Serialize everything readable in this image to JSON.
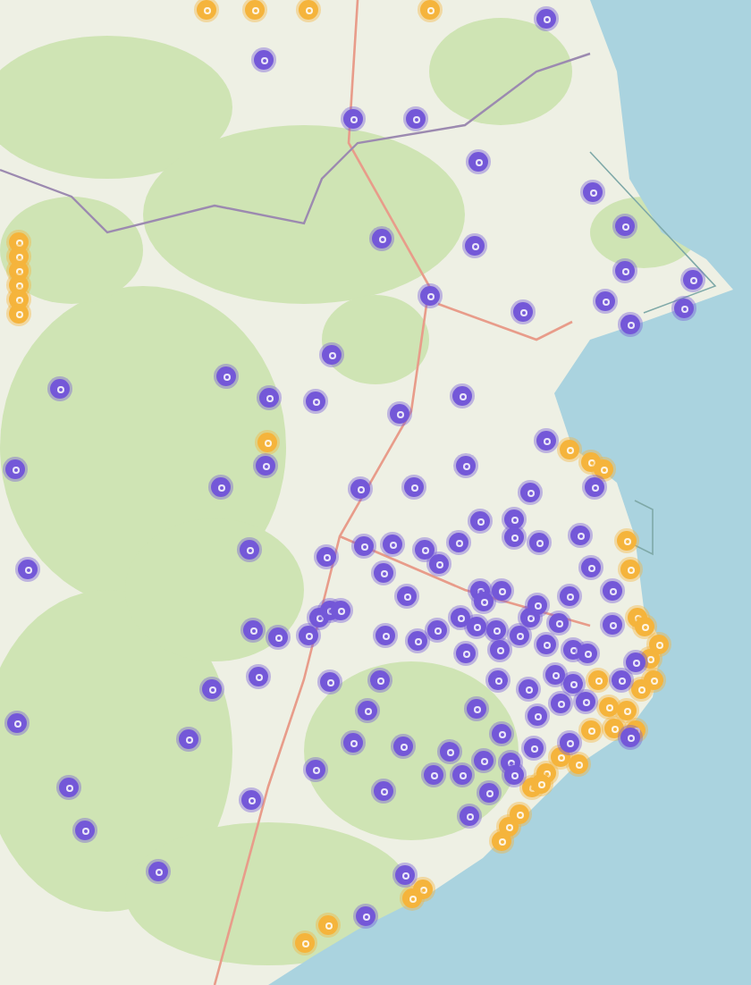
{
  "map": {
    "markers": [
      {
        "color": "#f5b43c"
      },
      {
        "color": "#f5b43c"
      },
      {
        "color": "#f5b43c"
      },
      {
        "color": "#f5b43c"
      },
      {
        "color": "#f5b43c"
      },
      {
        "color": "#f5b43c"
      },
      {
        "color": "#f5b43c"
      },
      {
        "color": "#f5b43c"
      },
      {
        "color": "#f5b43c"
      },
      {
        "color": "#f5b43c"
      },
      {
        "color": "#f5b43c"
      },
      {
        "color": "#f5b43c"
      },
      {
        "color": "#f5b43c"
      },
      {
        "color": "#f5b43c"
      },
      {
        "color": "#f5b43c"
      },
      {
        "color": "#f5b43c"
      },
      {
        "color": "#f5b43c"
      },
      {
        "color": "#f5b43c"
      },
      {
        "color": "#f5b43c"
      },
      {
        "color": "#f5b43c"
      },
      {
        "color": "#f5b43c"
      },
      {
        "color": "#f5b43c"
      },
      {
        "color": "#f5b43c"
      },
      {
        "color": "#f5b43c"
      },
      {
        "color": "#f5b43c"
      },
      {
        "color": "#f5b43c"
      },
      {
        "color": "#f5b43c"
      },
      {
        "color": "#f5b43c"
      },
      {
        "color": "#f5b43c"
      },
      {
        "color": "#f5b43c"
      },
      {
        "color": "#f5b43c"
      },
      {
        "color": "#f5b43c"
      },
      {
        "color": "#f5b43c"
      },
      {
        "color": "#f5b43c"
      },
      {
        "color": "#f5b43c"
      },
      {
        "color": "#f5b43c"
      },
      {
        "color": "#f5b43c"
      },
      {
        "color": "#f5b43c"
      },
      {
        "color": "#f5b43c"
      },
      {
        "color": "#f5b43c"
      },
      {
        "color": "#7458d8"
      },
      {
        "color": "#7458d8"
      },
      {
        "color": "#7458d8"
      },
      {
        "color": "#7458d8"
      },
      {
        "color": "#7458d8"
      },
      {
        "color": "#7458d8"
      },
      {
        "color": "#7458d8"
      },
      {
        "color": "#7458d8"
      },
      {
        "color": "#7458d8"
      },
      {
        "color": "#7458d8"
      },
      {
        "color": "#7458d8"
      },
      {
        "color": "#7458d8"
      },
      {
        "color": "#7458d8"
      },
      {
        "color": "#7458d8"
      },
      {
        "color": "#7458d8"
      },
      {
        "color": "#7458d8"
      },
      {
        "color": "#7458d8"
      },
      {
        "color": "#7458d8"
      },
      {
        "color": "#7458d8"
      },
      {
        "color": "#7458d8"
      },
      {
        "color": "#7458d8"
      },
      {
        "color": "#7458d8"
      },
      {
        "color": "#7458d8"
      },
      {
        "color": "#7458d8"
      },
      {
        "color": "#7458d8"
      },
      {
        "color": "#7458d8"
      },
      {
        "color": "#7458d8"
      },
      {
        "color": "#7458d8"
      },
      {
        "color": "#7458d8"
      },
      {
        "color": "#7458d8"
      },
      {
        "color": "#7458d8"
      },
      {
        "color": "#7458d8"
      },
      {
        "color": "#7458d8"
      },
      {
        "color": "#7458d8"
      },
      {
        "color": "#7458d8"
      },
      {
        "color": "#7458d8"
      },
      {
        "color": "#7458d8"
      },
      {
        "color": "#7458d8"
      },
      {
        "color": "#7458d8"
      },
      {
        "color": "#7458d8"
      },
      {
        "color": "#7458d8"
      },
      {
        "color": "#7458d8"
      },
      {
        "color": "#7458d8"
      },
      {
        "color": "#7458d8"
      },
      {
        "color": "#7458d8"
      },
      {
        "color": "#7458d8"
      },
      {
        "color": "#7458d8"
      },
      {
        "color": "#7458d8"
      },
      {
        "color": "#7458d8"
      },
      {
        "color": "#7458d8"
      },
      {
        "color": "#7458d8"
      },
      {
        "color": "#7458d8"
      },
      {
        "color": "#7458d8"
      },
      {
        "color": "#7458d8"
      },
      {
        "color": "#7458d8"
      },
      {
        "color": "#7458d8"
      },
      {
        "color": "#7458d8"
      },
      {
        "color": "#7458d8"
      },
      {
        "color": "#7458d8"
      },
      {
        "color": "#7458d8"
      },
      {
        "color": "#7458d8"
      },
      {
        "color": "#7458d8"
      },
      {
        "color": "#7458d8"
      },
      {
        "color": "#7458d8"
      },
      {
        "color": "#7458d8"
      },
      {
        "color": "#7458d8"
      },
      {
        "color": "#7458d8"
      },
      {
        "color": "#7458d8"
      },
      {
        "color": "#7458d8"
      },
      {
        "color": "#7458d8"
      },
      {
        "color": "#7458d8"
      },
      {
        "color": "#7458d8"
      },
      {
        "color": "#7458d8"
      },
      {
        "color": "#7458d8"
      },
      {
        "color": "#7458d8"
      },
      {
        "color": "#7458d8"
      },
      {
        "color": "#7458d8"
      },
      {
        "color": "#7458d8"
      },
      {
        "color": "#7458d8"
      },
      {
        "color": "#7458d8"
      },
      {
        "color": "#7458d8"
      },
      {
        "color": "#7458d8"
      },
      {
        "color": "#7458d8"
      },
      {
        "color": "#7458d8"
      },
      {
        "color": "#7458d8"
      },
      {
        "color": "#7458d8"
      },
      {
        "color": "#7458d8"
      },
      {
        "color": "#7458d8"
      },
      {
        "color": "#7458d8"
      },
      {
        "color": "#7458d8"
      },
      {
        "color": "#7458d8"
      },
      {
        "color": "#7458d8"
      },
      {
        "color": "#7458d8"
      },
      {
        "color": "#7458d8"
      },
      {
        "color": "#7458d8"
      },
      {
        "color": "#7458d8"
      },
      {
        "color": "#7458d8"
      },
      {
        "color": "#7458d8"
      },
      {
        "color": "#7458d8"
      },
      {
        "color": "#7458d8"
      },
      {
        "color": "#7458d8"
      },
      {
        "color": "#7458d8"
      },
      {
        "color": "#7458d8"
      },
      {
        "color": "#7458d8"
      },
      {
        "color": "#7458d8"
      },
      {
        "color": "#7458d8"
      },
      {
        "color": "#7458d8"
      },
      {
        "color": "#7458d8"
      },
      {
        "color": "#7458d8"
      },
      {
        "color": "#7458d8"
      },
      {
        "color": "#7458d8"
      },
      {
        "color": "#7458d8"
      },
      {
        "color": "#7458d8"
      },
      {
        "color": "#7458d8"
      }
    ]
  }
}
